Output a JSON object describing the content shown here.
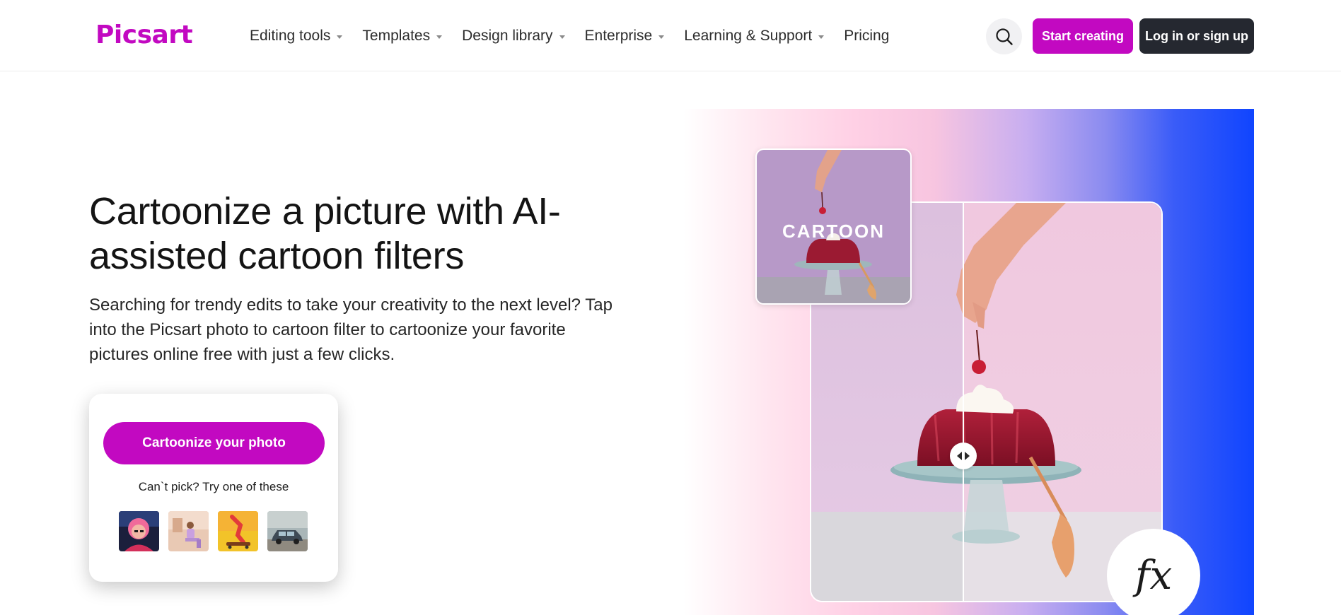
{
  "header": {
    "logo_text": "Picsart",
    "nav": [
      {
        "label": "Editing tools",
        "has_dropdown": true
      },
      {
        "label": "Templates",
        "has_dropdown": true
      },
      {
        "label": "Design library",
        "has_dropdown": true
      },
      {
        "label": "Enterprise",
        "has_dropdown": true
      },
      {
        "label": "Learning & Support",
        "has_dropdown": true
      },
      {
        "label": "Pricing",
        "has_dropdown": false
      }
    ],
    "search_icon": "search-icon",
    "start_label": "Start creating",
    "login_label": "Log in or sign up"
  },
  "hero": {
    "title": "Cartoonize a picture with AI-assisted cartoon filters",
    "description": "Searching for trendy edits to take your creativity to the next level? Tap into the Picsart photo to cartoon filter to cartoonize your favorite pictures online free with just a few clicks."
  },
  "cta": {
    "button_label": "Cartoonize your photo",
    "hint": "Can`t pick? Try one of these",
    "samples": [
      "sample-photo-portrait",
      "sample-photo-person-sitting",
      "sample-photo-skateboard",
      "sample-photo-car"
    ]
  },
  "visual": {
    "thumb_label": "CARTOON",
    "fx_badge": "fx",
    "compare_icon": "compare-arrows-icon"
  },
  "colors": {
    "brand": "#c209c1",
    "dark_button": "#252830",
    "gradient_end": "#1045ff"
  }
}
